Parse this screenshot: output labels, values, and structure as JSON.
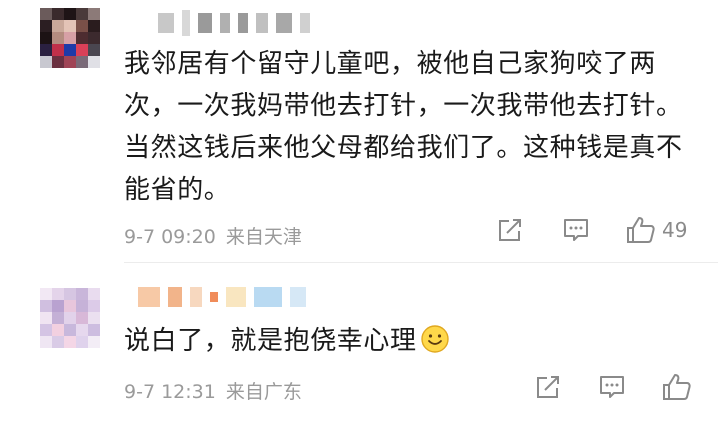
{
  "comments": [
    {
      "text": "我邻居有个留守儿童吧，被他自己家狗咬了两次，一次我妈带他去打针，一次我带他去打针。当然这钱后来他父母都给我们了。这种钱是真不能省的。",
      "time": "9-7 09:20",
      "source": "来自天津",
      "like_count": "49",
      "icons": [
        "share-icon",
        "comment-icon",
        "like-icon"
      ]
    },
    {
      "text": "说白了，就是抱侥幸心理",
      "emoji": "smile-emoji",
      "time": "9-7 12:31",
      "source": "来自广东",
      "like_count": "",
      "icons": [
        "share-icon",
        "comment-icon",
        "like-icon"
      ]
    }
  ]
}
